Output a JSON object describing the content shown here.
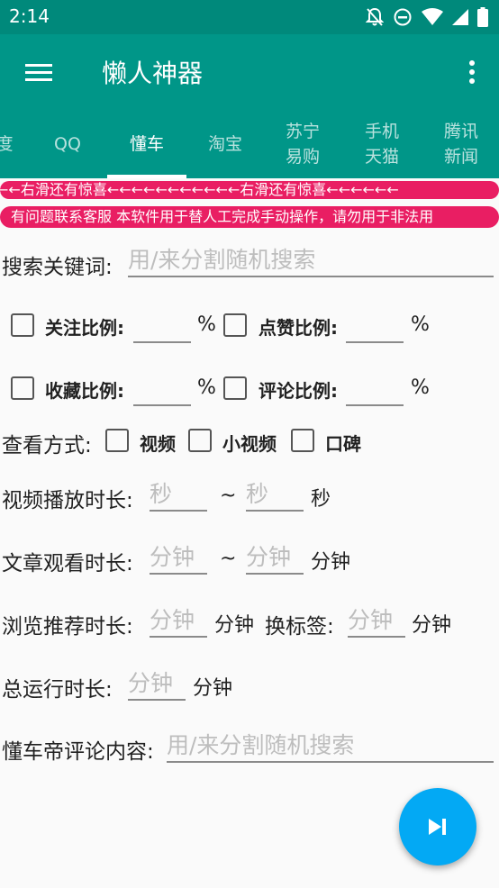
{
  "status_bar": {
    "time": "2:14"
  },
  "app_bar": {
    "title": "懒人神器"
  },
  "tabs": [
    {
      "label": "度"
    },
    {
      "label": "QQ"
    },
    {
      "label": "懂车"
    },
    {
      "label": "淘宝"
    },
    {
      "label": "苏宁\n易购"
    },
    {
      "label": "手机\n天猫"
    },
    {
      "label": "腾讯\n新闻"
    }
  ],
  "active_tab": "懂车",
  "marquee": {
    "line1": "←←右滑还有惊喜←←←←←←←←←←←右滑还有惊喜←←←←←←",
    "line2": "有问题联系客服 本软件用于替人工完成手动操作，请勿用于非法用"
  },
  "form": {
    "search_label": "搜索关键词:",
    "search_placeholder": "用/来分割随机搜索",
    "follow_label": "关注比例:",
    "like_label": "点赞比例:",
    "collect_label": "收藏比例:",
    "comment_label": "评论比例:",
    "percent": "%",
    "view_mode_label": "查看方式:",
    "view_video": "视频",
    "view_small_video": "小视频",
    "view_reputation": "口碑",
    "video_duration_label": "视频播放时长:",
    "sec_placeholder": "秒",
    "tilde": "~",
    "sec_unit": "秒",
    "article_duration_label": "文章观看时长:",
    "min_placeholder": "分钟",
    "min_unit": "分钟",
    "browse_label": "浏览推荐时长:",
    "switch_tab_label": "换标签:",
    "total_label": "总运行时长:",
    "comment_content_label": "懂车帝评论内容:",
    "comment_content_placeholder": "用/来分割随机搜索"
  },
  "colors": {
    "primary": "#009688",
    "status": "#00897b",
    "accent": "#03a9f4",
    "marquee": "#e91e63"
  }
}
